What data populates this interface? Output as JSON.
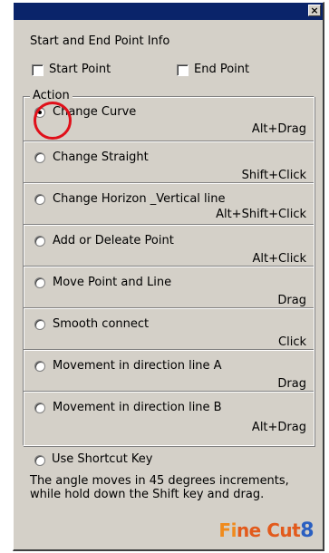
{
  "window": {
    "close_glyph": "×"
  },
  "section_title": "Start and End Point Info",
  "checkboxes": [
    {
      "label": "Start Point",
      "checked": false
    },
    {
      "label": "End Point",
      "checked": false
    }
  ],
  "group": {
    "legend": "Action",
    "options": [
      {
        "label": "Change Curve",
        "shortcut": "Alt+Drag",
        "selected": true
      },
      {
        "label": "Change Straight",
        "shortcut": "Shift+Click",
        "selected": false
      },
      {
        "label": "Change Horizon _Vertical line",
        "shortcut": "Alt+Shift+Click",
        "selected": false
      },
      {
        "label": "Add or Deleate Point",
        "shortcut": "Alt+Click",
        "selected": false
      },
      {
        "label": "Move Point and Line",
        "shortcut": "Drag",
        "selected": false
      },
      {
        "label": "Smooth connect",
        "shortcut": "Click",
        "selected": false
      },
      {
        "label": "Movement in direction line A",
        "shortcut": "Drag",
        "selected": false
      },
      {
        "label": "Movement in direction line B",
        "shortcut": "Alt+Drag",
        "selected": false
      }
    ]
  },
  "shortcut_option": {
    "label": "Use Shortcut Key",
    "selected": false
  },
  "note": "The angle moves in 45 degrees increments, while hold down the Shift key and drag.",
  "logo": {
    "part1": "Fi",
    "part2": "ne Cut",
    "part3": "8"
  },
  "colors": {
    "title_bar": "#0a246a",
    "dialog_bg": "#d4d0c8",
    "highlight_circle": "#e0101a",
    "logo_orange": "#f08a1c",
    "logo_blue": "#2a5fc1"
  }
}
